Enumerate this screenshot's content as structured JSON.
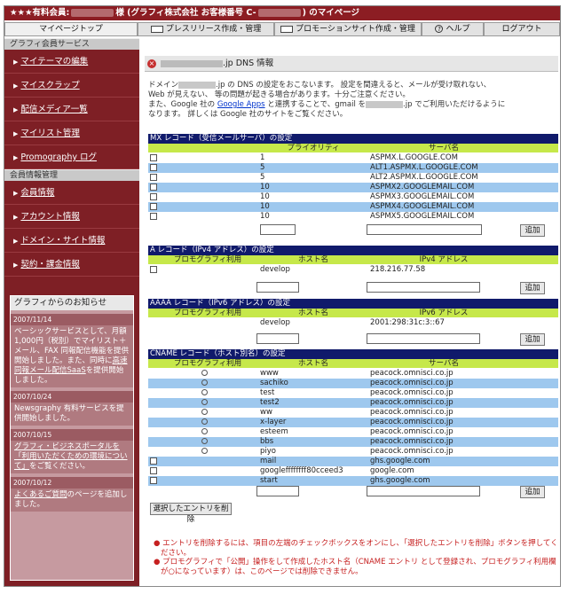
{
  "header": {
    "prefix": "★★★有料会員:",
    "suffix": "様 (グラフィ株式会社 お客様番号 C-",
    "suffix2": ") のマイページ"
  },
  "nav": {
    "mypage": "マイページトップ",
    "press": "プレスリリース作成・管理",
    "promo": "プロモーションサイト作成・管理",
    "help": "ヘルプ",
    "logout": "ログアウト"
  },
  "sidebar": {
    "sec1": "グラフィ会員サービス",
    "items1": [
      "マイテーマの編集",
      "マイスクラップ",
      "配信メディア一覧",
      "マイリスト管理",
      "Promography ログ"
    ],
    "sec2": "会員情報管理",
    "items2": [
      "会員情報",
      "アカウント情報",
      "ドメイン・サイト情報",
      "契約・課金情報"
    ]
  },
  "news": {
    "title": "グラフィからのお知らせ",
    "items": [
      {
        "date": "2007/11/14",
        "text": "ベーシックサービスとして、月額1,000円（税別）でマイリスト＋メール、FAX 同報配信機能を提供開始しました。また、同時に",
        "link": "高速同報メール配信SaaS",
        "tail": "を提供開始しました。"
      },
      {
        "date": "2007/10/24",
        "text": "Newsgraphy 有料サービスを提供開始しました。",
        "link": "",
        "tail": ""
      },
      {
        "date": "2007/10/15",
        "text": "",
        "link": "グラフィ・ビジネスポータルを「利用いただくための環境について」",
        "tail": "をご覧ください。"
      },
      {
        "date": "2007/10/12",
        "text": "",
        "link": "よくあるご質問",
        "tail": "のページを追加しました。"
      }
    ]
  },
  "page": {
    "title": ".jp DNS 情報"
  },
  "intro": {
    "l1a": "ドメイン",
    "l1b": ".jp の DNS の設定をおこないます。 設定を間違えると、メールが受け取れない、",
    "l2": "Web が見えない、 等の問題が起きる場合があります。十分ご注意ください。",
    "l3a": "また、Google 社の ",
    "l3link": "Google Apps",
    "l3b": " と連携することで、gmail を",
    "l3c": ".jp でご利用いただけるように",
    "l4": "なります。 詳しくは Google 社のサイトをご覧ください。"
  },
  "mx": {
    "title": "MX レコード（受信メールサーバ）の設定",
    "h_pri": "プライオリティ",
    "h_server": "サーバ名",
    "rows": [
      [
        "1",
        "ASPMX.L.GOOGLE.COM"
      ],
      [
        "5",
        "ALT1.ASPMX.L.GOOGLE.COM"
      ],
      [
        "5",
        "ALT2.ASPMX.L.GOOGLE.COM"
      ],
      [
        "10",
        "ASPMX2.GOOGLEMAIL.COM"
      ],
      [
        "10",
        "ASPMX3.GOOGLEMAIL.COM"
      ],
      [
        "10",
        "ASPMX4.GOOGLEMAIL.COM"
      ],
      [
        "10",
        "ASPMX5.GOOGLEMAIL.COM"
      ]
    ]
  },
  "a": {
    "title": "A レコード（IPv4 アドレス）の設定",
    "h_use": "プロモグラフィ利用",
    "h_host": "ホスト名",
    "h_addr": "IPv4 アドレス",
    "rows": [
      [
        "develop",
        "218.216.77.58"
      ]
    ]
  },
  "aaaa": {
    "title": "AAAA レコード（IPv6 アドレス）の設定",
    "h_use": "プロモグラフィ利用",
    "h_host": "ホスト名",
    "h_addr": "IPv6 アドレス",
    "rows": [
      [
        "develop",
        "2001:298:31c:3::67"
      ]
    ]
  },
  "cname": {
    "title": "CNAME レコード（ホスト別名）の設定",
    "h_use": "プロモグラフィ利用",
    "h_host": "ホスト名",
    "h_server": "サーバ名",
    "rows": [
      [
        "www",
        "peacock.omnisci.co.jp"
      ],
      [
        "sachiko",
        "peacock.omnisci.co.jp"
      ],
      [
        "test",
        "peacock.omnisci.co.jp"
      ],
      [
        "test2",
        "peacock.omnisci.co.jp"
      ],
      [
        "ww",
        "peacock.omnisci.co.jp"
      ],
      [
        "x-layer",
        "peacock.omnisci.co.jp"
      ],
      [
        "esteem",
        "peacock.omnisci.co.jp"
      ],
      [
        "bbs",
        "peacock.omnisci.co.jp"
      ],
      [
        "piyo",
        "peacock.omnisci.co.jp"
      ],
      [
        "mail",
        "ghs.google.com"
      ],
      [
        "googleffffffff80cceed3",
        "google.com"
      ],
      [
        "start",
        "ghs.google.com"
      ]
    ]
  },
  "buttons": {
    "add": "追加",
    "delete": "選択したエントリを削除"
  },
  "notes": [
    "エントリを削除するには、項目の左端のチェックボックスをオンにし、「選択したエントリを削除」ボタンを押してください。",
    "プロモグラフィで「公開」操作をして作成したホスト名（CNAME エントリ として登録され、プロモグラフィ利用欄が○になっています）は、このページでは削除できません。"
  ],
  "colors": {
    "topbar": "#8c1d23",
    "sidebar": "#7e1f25",
    "section_header": "#101a6b",
    "col_header": "#c6e84a",
    "alt_row": "#9ec8ee",
    "note": "#c62020"
  }
}
